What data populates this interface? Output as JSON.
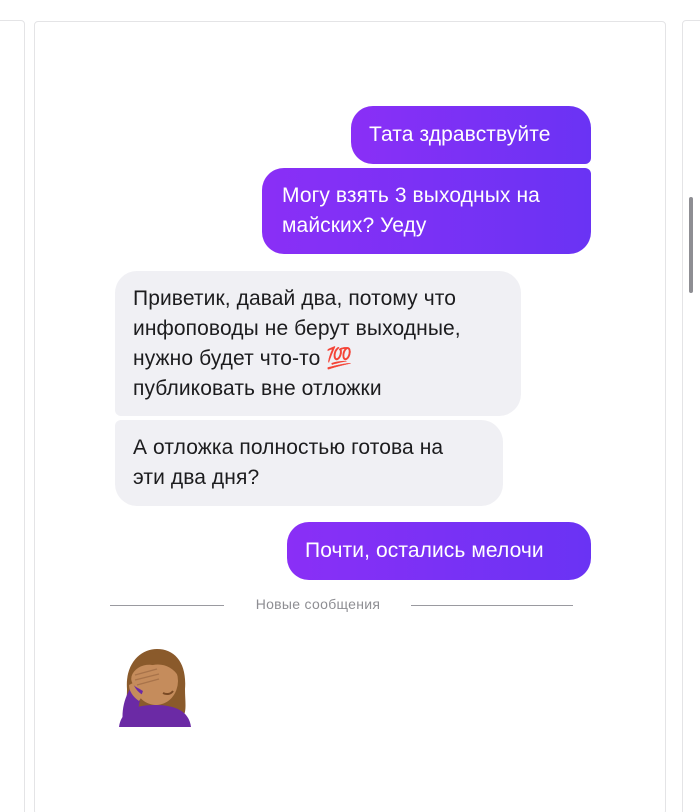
{
  "messages": [
    {
      "direction": "outgoing",
      "text": "Тата здравствуйте"
    },
    {
      "direction": "outgoing",
      "lines": [
        "Могу взять 3 выходных на",
        "майских? Уеду"
      ]
    },
    {
      "direction": "incoming",
      "lines": [
        "Приветик, давай два, потому что",
        "инфоповоды не берут выходные,",
        "нужно будет что-то 💯",
        "публиковать вне отложки"
      ]
    },
    {
      "direction": "incoming",
      "lines": [
        "А отложка полностью готова на",
        "эти два дня?"
      ]
    },
    {
      "direction": "outgoing",
      "text": "Почти, остались мелочи"
    }
  ],
  "divider": {
    "label": "Новые сообщения"
  },
  "sticker": {
    "icon": "facepalm-woman-icon",
    "emoji": "🤦‍♀️"
  },
  "colors": {
    "outgoing_bubble": "#7a2ff7",
    "incoming_bubble": "#f0f0f4",
    "divider": "#9a9aa0"
  }
}
